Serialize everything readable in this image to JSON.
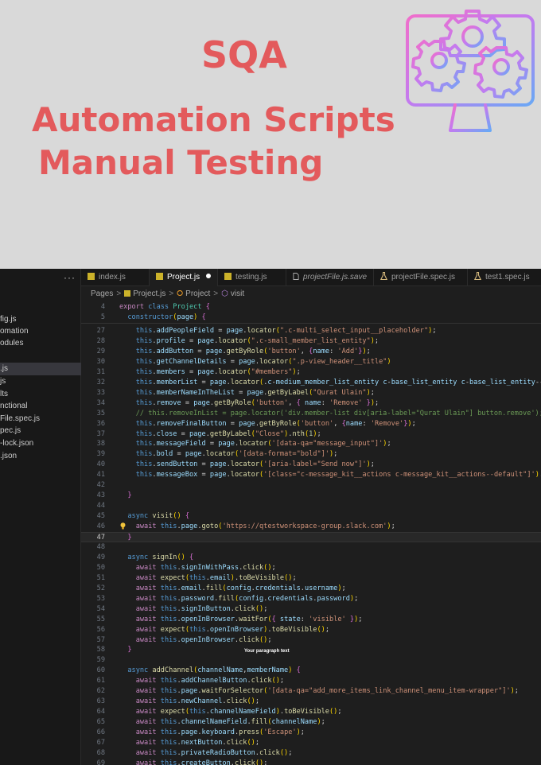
{
  "banner": {
    "title": "SQA",
    "line2": "Automation Scripts",
    "line3": "Manual Testing",
    "icon": "gear-monitor-icon",
    "accent": "#e35a5c"
  },
  "sidebar": {
    "more": "···",
    "files": [
      "fig.js",
      "omation",
      "odules",
      "",
      ".js",
      "js",
      "lts",
      "nctional",
      "File.spec.js",
      "pec.js",
      "-lock.json",
      ".json"
    ]
  },
  "tabs": [
    {
      "label": "index.js",
      "icon": "js-icon"
    },
    {
      "label": "Project.js",
      "icon": "js-icon",
      "active": true,
      "modified": true
    },
    {
      "label": "testing.js",
      "icon": "js-icon"
    },
    {
      "label": "projectFile.js.save",
      "icon": "file-icon",
      "italic": true
    },
    {
      "label": "projectFile.spec.js",
      "icon": "flask-icon"
    },
    {
      "label": "test1.spec.js",
      "icon": "flask-icon"
    }
  ],
  "breadcrumb": {
    "p1": "Pages",
    "p2": "Project.js",
    "p3": "Project",
    "p4": "visit"
  },
  "overlay_text": "Your paragraph text",
  "code": {
    "lines": [
      {
        "n": "4",
        "t": "export class Project {"
      },
      {
        "n": "5",
        "t": "  constructor(page) {"
      },
      {
        "n": "27",
        "t": "    this.addPeopleField = page.locator(\".c-multi_select_input__placeholder\");"
      },
      {
        "n": "28",
        "t": "    this.profile = page.locator(\".c-small_member_list_entity\");"
      },
      {
        "n": "29",
        "t": "    this.addButton = page.getByRole('button', {name: 'Add'});"
      },
      {
        "n": "30",
        "t": "    this.getChannelDetails = page.locator(\".p-view_header__title\")"
      },
      {
        "n": "31",
        "t": "    this.members = page.locator(\"#members\");"
      },
      {
        "n": "32",
        "t": "    this.memberList = page.locator(\".c-medium_member_list_entity c-base_list_entity c-base_list_entity--"
      },
      {
        "n": "33",
        "t": "    this.memberNameInTheList = page.getByLabel(\"Qurat Ulain\");"
      },
      {
        "n": "34",
        "t": "    this.remove = page.getByRole('button', { name: 'Remove' });"
      },
      {
        "n": "35",
        "t": "    // this.removeInList = page.locator('div.member-list div[aria-label=\"Qurat Ulain\"] button.remove');"
      },
      {
        "n": "36",
        "t": "    this.removeFinalButton = page.getByRole('button', {name: 'Remove'});"
      },
      {
        "n": "37",
        "t": "    this.close = page.getByLabel(\"Close\").nth(1);"
      },
      {
        "n": "38",
        "t": "    this.messageField = page.locator('[data-qa=\"message_input\"]');"
      },
      {
        "n": "39",
        "t": "    this.bold = page.locator('[data-format=\"bold\"]');"
      },
      {
        "n": "40",
        "t": "    this.sendButton = page.locator('[aria-label=\"Send now\"]');"
      },
      {
        "n": "41",
        "t": "    this.messageBox = page.locator('[class=\"c-message_kit__actions c-message_kit__actions--default\"]').nth"
      },
      {
        "n": "42",
        "t": ""
      },
      {
        "n": "43",
        "t": "  }"
      },
      {
        "n": "44",
        "t": ""
      },
      {
        "n": "45",
        "t": "  async visit() {"
      },
      {
        "n": "46",
        "t": "    await this.page.goto('https://qtestworkspace-group.slack.com');"
      },
      {
        "n": "47",
        "t": "  }"
      },
      {
        "n": "48",
        "t": ""
      },
      {
        "n": "49",
        "t": "  async signIn() {"
      },
      {
        "n": "50",
        "t": "    await this.signInWithPass.click();"
      },
      {
        "n": "51",
        "t": "    await expect(this.email).toBeVisible();"
      },
      {
        "n": "52",
        "t": "    await this.email.fill(config.credentials.username);"
      },
      {
        "n": "53",
        "t": "    await this.password.fill(config.credentials.password);"
      },
      {
        "n": "54",
        "t": "    await this.signInButton.click();"
      },
      {
        "n": "55",
        "t": "    await this.openInBrowser.waitFor({ state: 'visible' });"
      },
      {
        "n": "56",
        "t": "    await expect(this.openInBrowser).toBeVisible();"
      },
      {
        "n": "57",
        "t": "    await this.openInBrowser.click();"
      },
      {
        "n": "58",
        "t": "  }"
      },
      {
        "n": "59",
        "t": ""
      },
      {
        "n": "60",
        "t": "  async addChannel(channelName,memberName) {"
      },
      {
        "n": "61",
        "t": "    await this.addChannelButton.click();"
      },
      {
        "n": "62",
        "t": "    await this.page.waitForSelector('[data-qa=\"add_more_items_link_channel_menu_item-wrapper\"]');"
      },
      {
        "n": "63",
        "t": "    await this.newChannel.click();"
      },
      {
        "n": "64",
        "t": "    await expect(this.channelNameField).toBeVisible();"
      },
      {
        "n": "65",
        "t": "    await this.channelNameField.fill(channelName);"
      },
      {
        "n": "66",
        "t": "    await this.page.keyboard.press('Escape');"
      },
      {
        "n": "67",
        "t": "    await this.nextButton.click();"
      },
      {
        "n": "68",
        "t": "    await this.privateRadioButton.click();"
      },
      {
        "n": "69",
        "t": "    await this.createButton.click();"
      }
    ]
  }
}
